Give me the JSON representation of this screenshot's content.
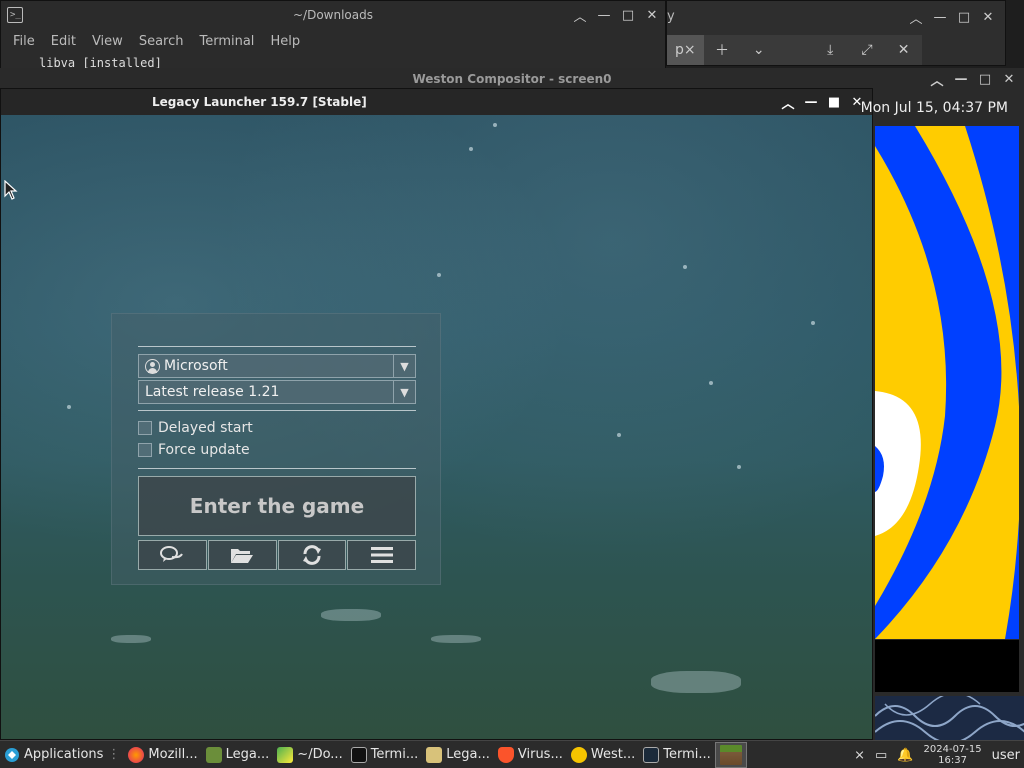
{
  "terminal": {
    "title": "~/Downloads",
    "menu": [
      "File",
      "Edit",
      "View",
      "Search",
      "Terminal",
      "Help"
    ],
    "visible_text": "libva [installed]"
  },
  "browser": {
    "title_fragment": "y",
    "tab_fragment": "p",
    "tab_close": "×"
  },
  "weston": {
    "title": "Weston Compositor - screen0",
    "clock": "Mon Jul 15, 04:37 PM"
  },
  "launcher": {
    "title": "Legacy Launcher 159.7 [Stable]",
    "account": "Microsoft",
    "version": "Latest release 1.21",
    "delayed_start": "Delayed start",
    "force_update": "Force update",
    "play_label": "Enter the game"
  },
  "taskbar": {
    "start_label": "Applications",
    "tasks": [
      {
        "label": "Mozill...",
        "icon": "firefox-icon"
      },
      {
        "label": "Lega...",
        "icon": "launcher-icon"
      },
      {
        "label": "~/Do...",
        "icon": "editor-icon"
      },
      {
        "label": "Termi...",
        "icon": "terminal-icon"
      },
      {
        "label": "Lega...",
        "icon": "folder-icon"
      },
      {
        "label": "Virus...",
        "icon": "brave-icon"
      },
      {
        "label": "West...",
        "icon": "weston-icon"
      },
      {
        "label": "Termi...",
        "icon": "terminal-icon"
      }
    ],
    "date": "2024-07-15",
    "time": "16:37",
    "user": "user"
  },
  "colors": {
    "accent_yellow": "#ffcc00",
    "accent_blue": "#0040ff",
    "scene": "#2d5866"
  }
}
